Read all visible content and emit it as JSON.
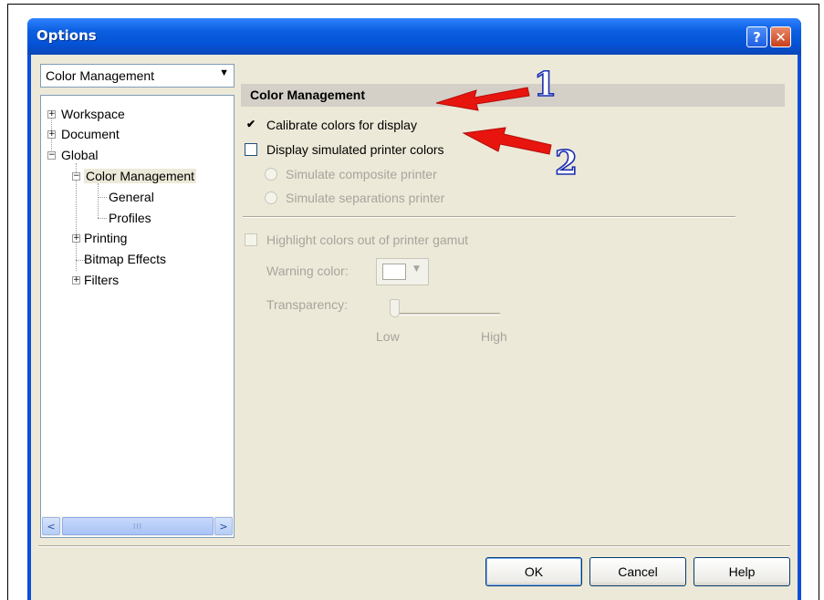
{
  "window": {
    "title": "Options",
    "help_glyph": "?",
    "close_glyph": "✕"
  },
  "nav": {
    "combo_value": "Color Management",
    "tree": [
      {
        "label": "Workspace",
        "expander": "+"
      },
      {
        "label": "Document",
        "expander": "+"
      },
      {
        "label": "Global",
        "expander": "−"
      },
      {
        "label": "Color Management",
        "expander": "−"
      },
      {
        "label": "General"
      },
      {
        "label": "Profiles"
      },
      {
        "label": "Printing",
        "expander": "+"
      },
      {
        "label": "Bitmap Effects"
      },
      {
        "label": "Filters",
        "expander": "+"
      }
    ],
    "scroll_left": "<",
    "scroll_right": ">",
    "scroll_grip": "III"
  },
  "panel": {
    "header": "Color Management",
    "calibrate": {
      "label": "Calibrate colors for display",
      "checked": true
    },
    "simulate_printer": {
      "label": "Display simulated printer colors",
      "checked": false
    },
    "composite": {
      "label": "Simulate composite printer"
    },
    "separations": {
      "label": "Simulate separations printer"
    },
    "highlight_gamut": {
      "label": "Highlight colors out of printer gamut"
    },
    "warning_color_label": "Warning color:",
    "transparency_label": "Transparency:",
    "slider_low": "Low",
    "slider_high": "High",
    "transparency_value": 0
  },
  "buttons": {
    "ok": "OK",
    "cancel": "Cancel",
    "help": "Help"
  },
  "annotations": {
    "one": "1",
    "two": "2",
    "arrow_color": "#e8150f"
  }
}
